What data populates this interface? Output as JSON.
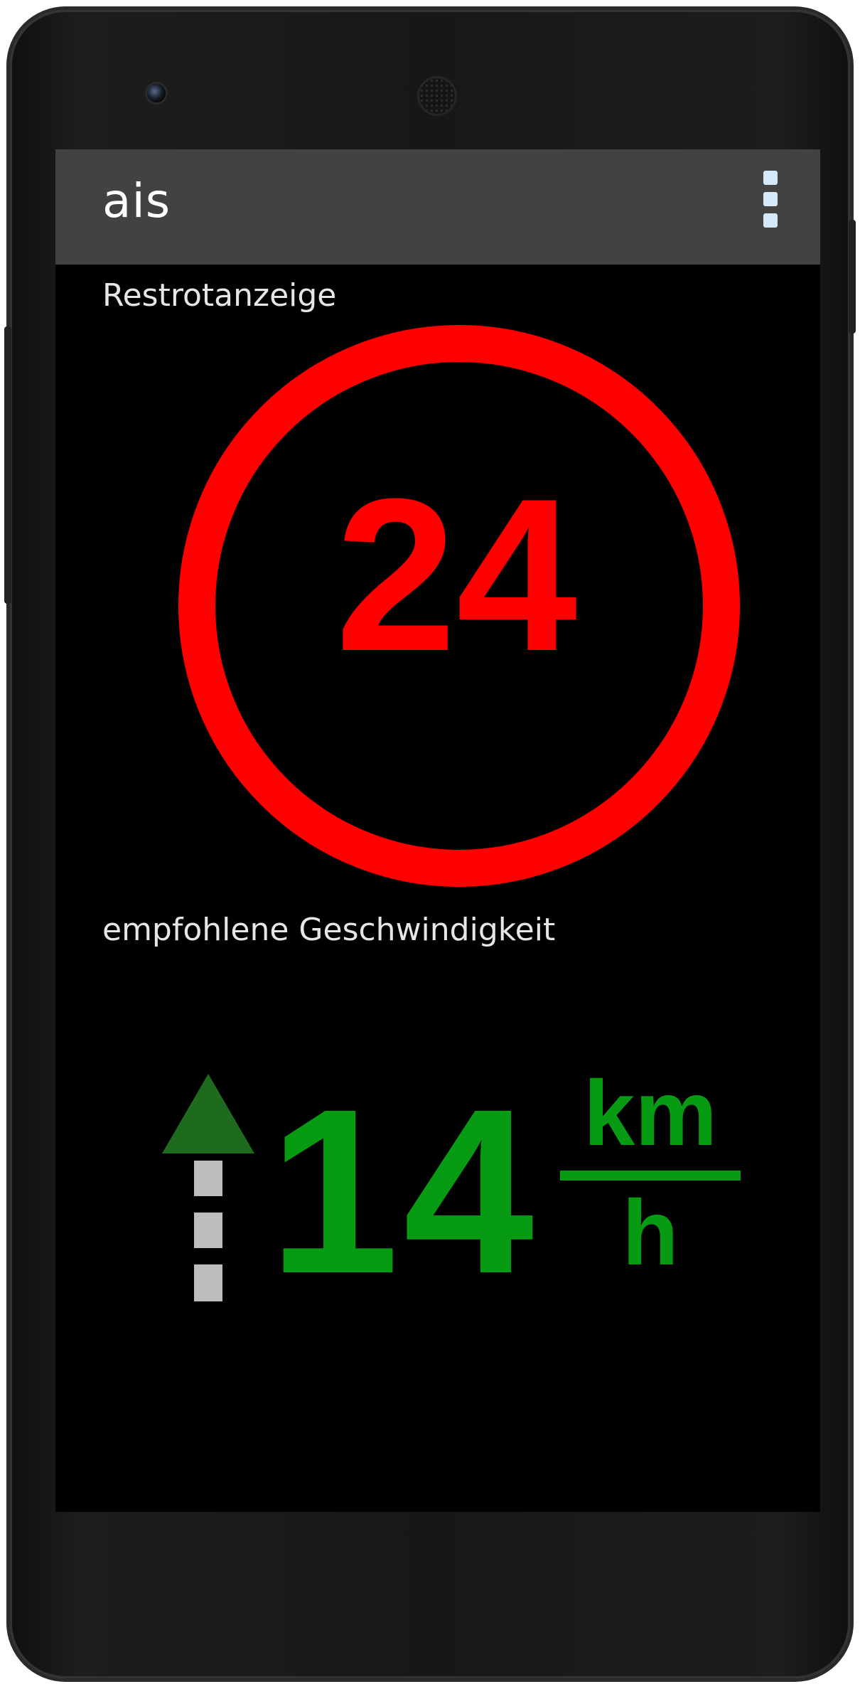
{
  "actionbar": {
    "title": "ais",
    "menu_icon": "overflow-menu-icon"
  },
  "restrot": {
    "label": "Restrotanzeige",
    "value": "24",
    "color": "#ff0000"
  },
  "speed": {
    "label": "empfohlene Geschwindigkeit",
    "value": "14",
    "unit_numerator": "km",
    "unit_denominator": "h",
    "color": "#079b14",
    "direction_icon": "straight-ahead-arrow-icon"
  },
  "colors": {
    "actionbar_bg": "#424242",
    "screen_bg": "#000000",
    "menu_dots": "#d6e9f8",
    "arrow_head": "#1e6b1e",
    "arrow_dashes": "#bdbdbd"
  }
}
